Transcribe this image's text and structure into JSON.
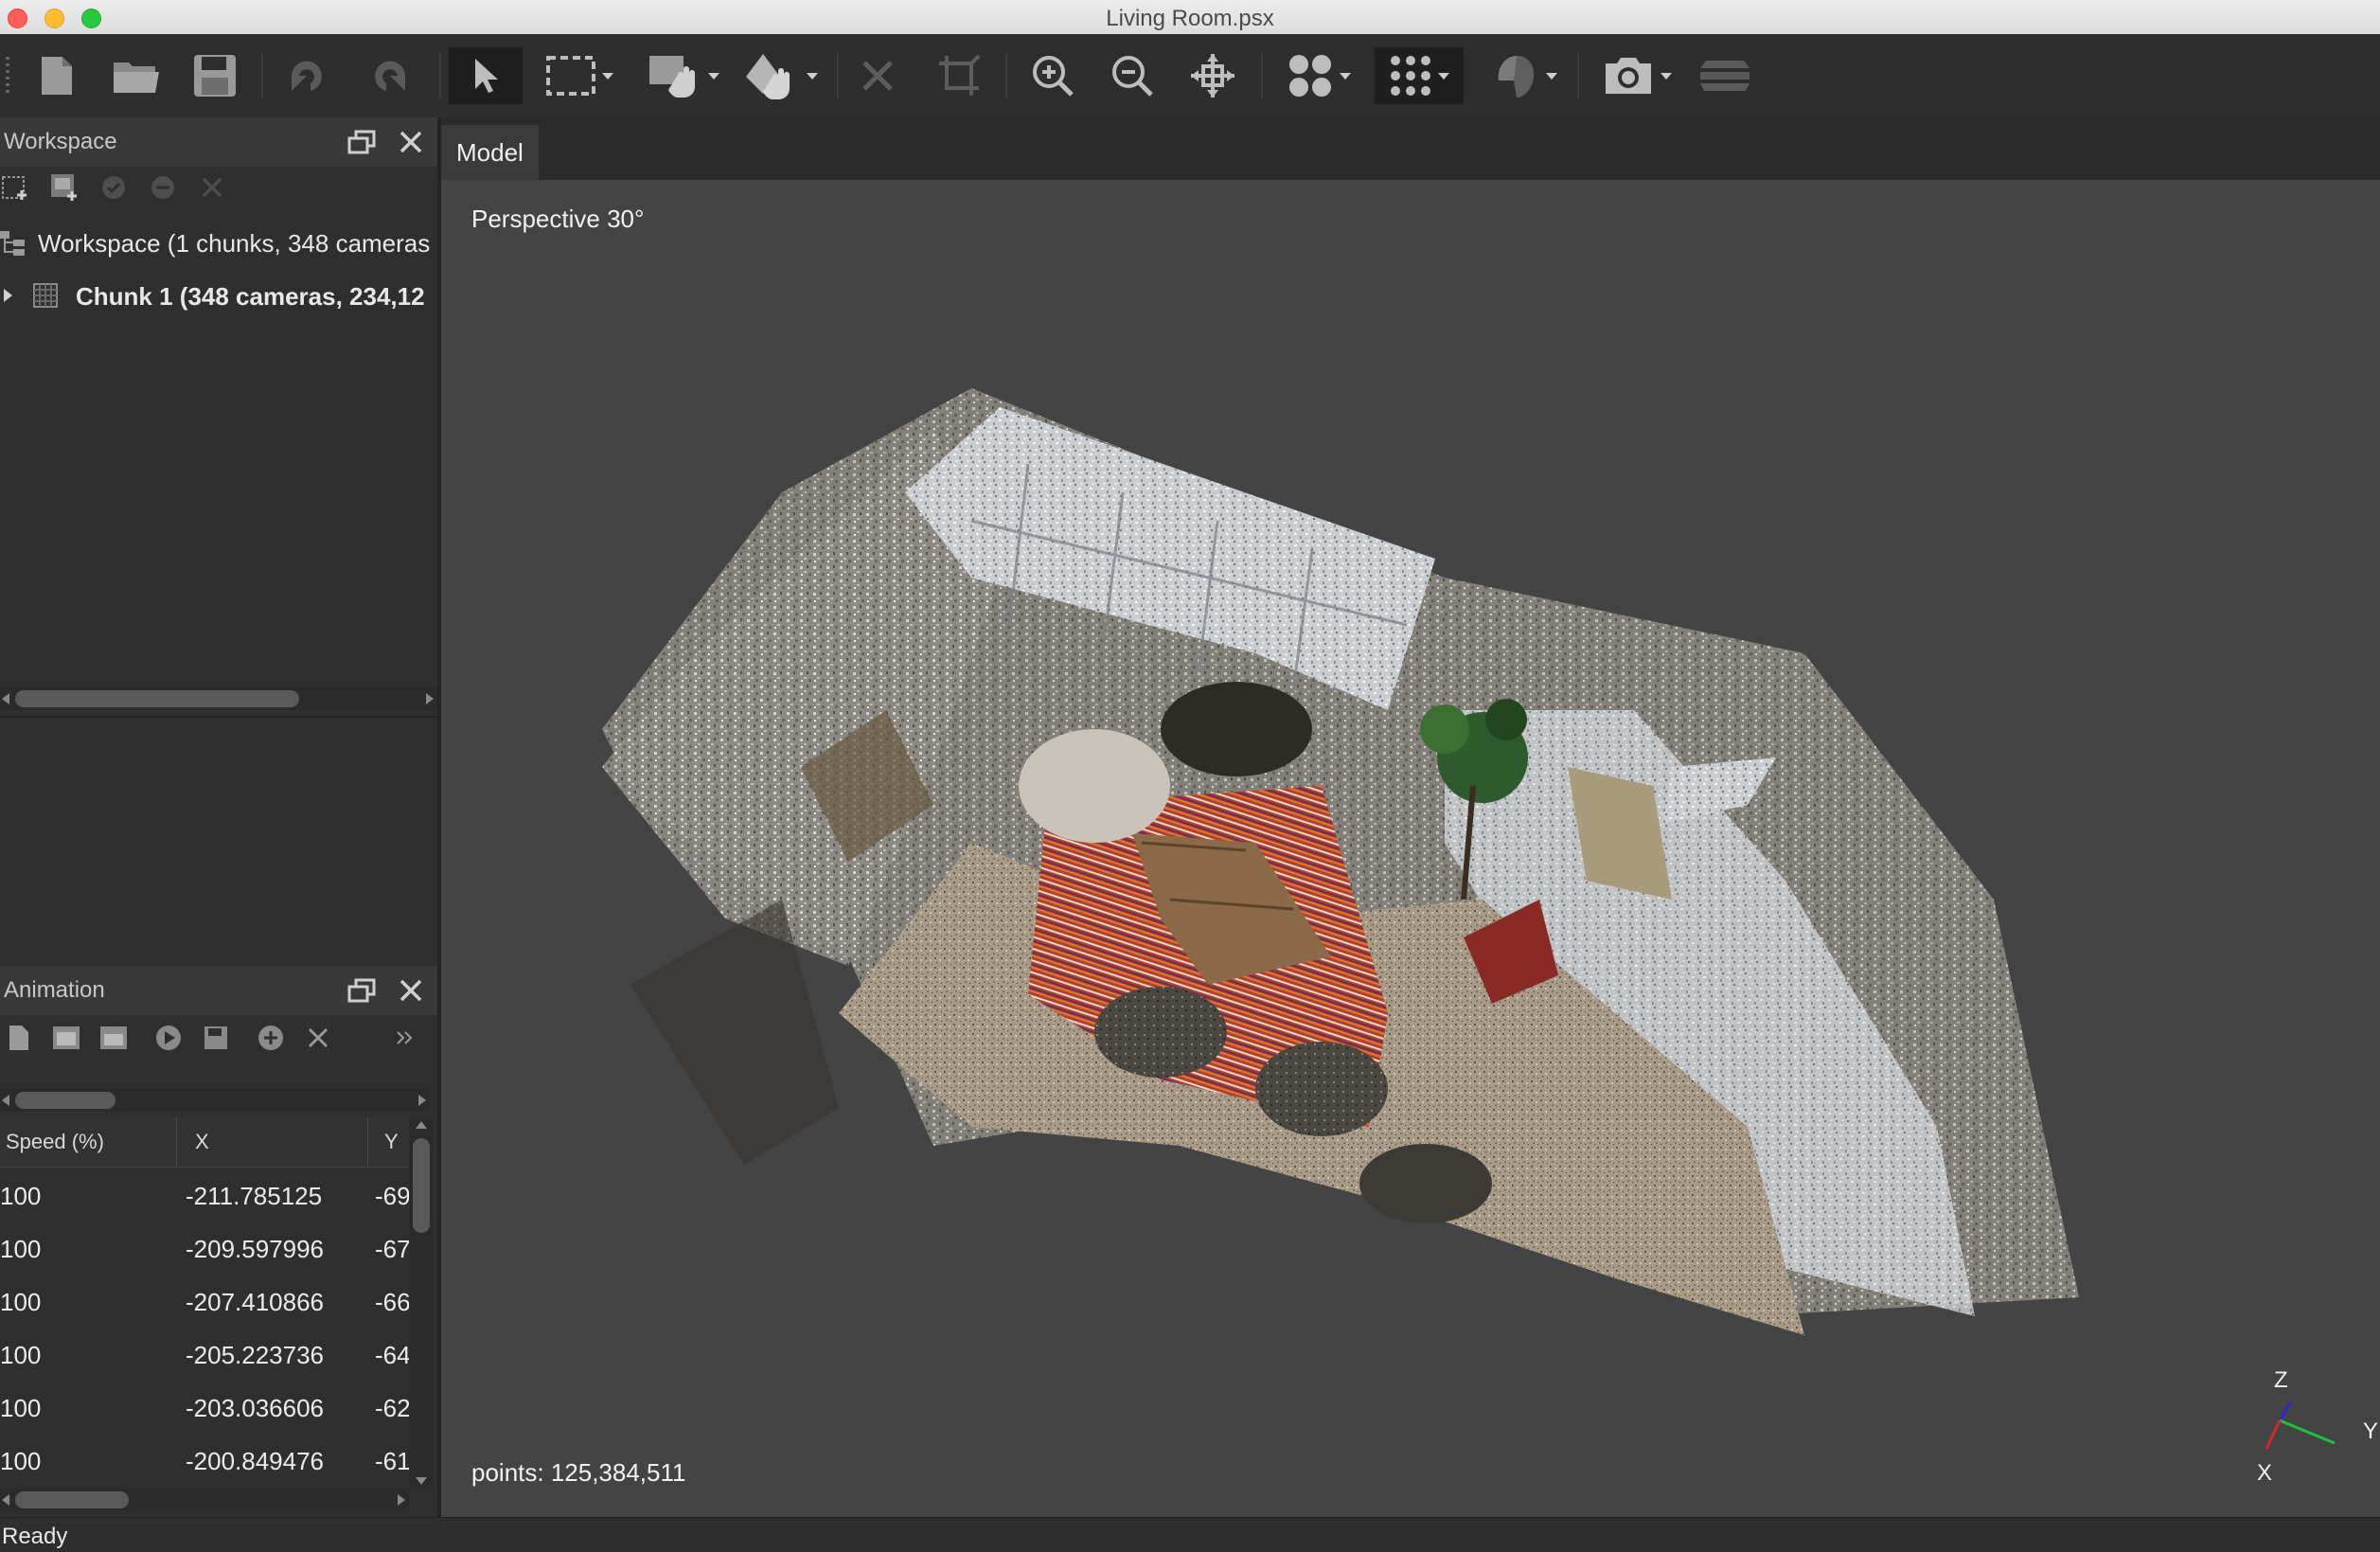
{
  "window": {
    "title": "Living Room.psx"
  },
  "toolbar": {
    "icons": [
      "new-document-icon",
      "open-folder-icon",
      "save-icon",
      "undo-icon",
      "redo-icon",
      "pointer-icon",
      "rectangle-selection-icon",
      "intelligent-scissors-icon",
      "intelligent-paint-icon",
      "delete-selection-icon",
      "crop-selection-icon",
      "zoom-in-icon",
      "zoom-out-icon",
      "move-object-icon",
      "point-cloud-icon",
      "dense-cloud-icon",
      "mesh-shaded-icon",
      "camera-icon",
      "layers-icon"
    ]
  },
  "workspace": {
    "title": "Workspace",
    "root_label": "Workspace (1 chunks, 348 cameras",
    "chunk_label": "Chunk 1 (348 cameras, 234,1",
    "chunk_suffix": "2"
  },
  "animation": {
    "title": "Animation",
    "columns": [
      "Speed (%)",
      "X",
      "Y"
    ],
    "rows": [
      {
        "speed": "100",
        "x": "-211.785125",
        "y": "-69"
      },
      {
        "speed": "100",
        "x": "-209.597996",
        "y": "-67"
      },
      {
        "speed": "100",
        "x": "-207.410866",
        "y": "-66"
      },
      {
        "speed": "100",
        "x": "-205.223736",
        "y": "-64"
      },
      {
        "speed": "100",
        "x": "-203.036606",
        "y": "-62"
      },
      {
        "speed": "100",
        "x": "-200.849476",
        "y": "-61"
      }
    ]
  },
  "viewport": {
    "tab": "Model",
    "projection": "Perspective 30°",
    "points": "points: 125,384,511",
    "axes": {
      "x": "X",
      "y": "Y",
      "z": "Z"
    }
  },
  "status": {
    "text": "Ready"
  },
  "colors": {
    "bg": "#3a3a3a",
    "viewport": "#444444",
    "panel": "#2f2f2f"
  }
}
